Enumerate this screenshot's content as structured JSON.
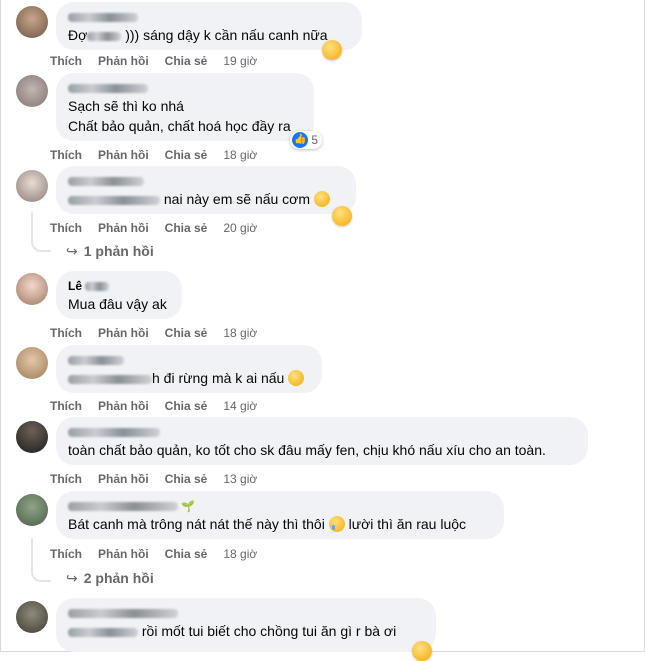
{
  "actions": {
    "like": "Thích",
    "reply": "Phản hồi",
    "share": "Chia sẻ"
  },
  "comments": [
    {
      "text1": ")))  sáng dậy k cần nấu canh nữa",
      "time": "19 giờ"
    },
    {
      "line1": "Sạch sẽ thì ko nhá",
      "line2": "Chất bảo quản, chất hoá học đầy ra",
      "time": "18 giờ",
      "reaction_count": "5"
    },
    {
      "text1": "nai này em sẽ nấu cơm",
      "time": "20 giờ",
      "replies": "1 phản hồi"
    },
    {
      "name_visible": "Lê",
      "text1": "Mua đâu vậy ak",
      "time": "18 giờ"
    },
    {
      "text1": "h đi rừng mà k ai nấu",
      "time": "14 giờ"
    },
    {
      "text1": "toàn chất bảo quản, ko tốt cho sk đâu mấy fen, chịu khó nấu xíu cho an toàn.",
      "time": "13 giờ"
    },
    {
      "text1": "Bát canh mà trông nát nát thế này thì thôi",
      "text2": "lười thì ăn rau luộc",
      "time": "18 giờ",
      "replies": "2 phản hồi"
    },
    {
      "text1": "rồi mốt tui biết cho chồng tui ăn gì r bà ơi"
    }
  ]
}
